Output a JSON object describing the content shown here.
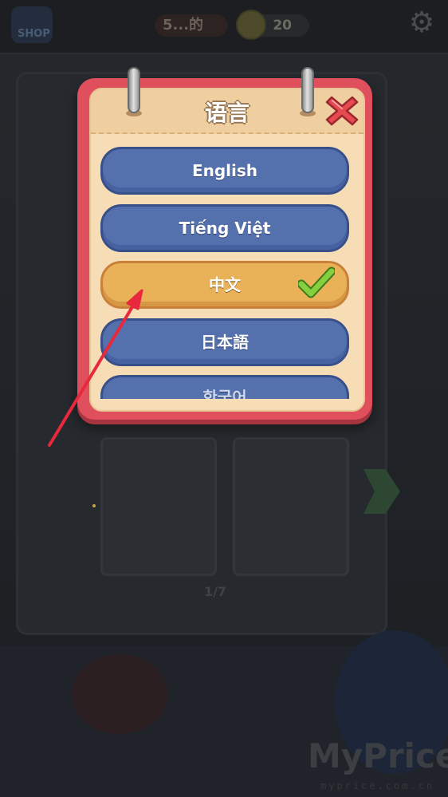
{
  "hud": {
    "level_label": "5...的",
    "coins": "20",
    "shop_label": "SHOP"
  },
  "background": {
    "page_counter": "1/7"
  },
  "dialog": {
    "title": "语言",
    "selected_language": "中文",
    "languages": [
      {
        "label": "English",
        "selected": false
      },
      {
        "label": "Tiếng Việt",
        "selected": false
      },
      {
        "label": "中文",
        "selected": true
      },
      {
        "label": "日本語",
        "selected": false
      },
      {
        "label": "한국어",
        "selected": false
      }
    ]
  },
  "watermark": {
    "brand": "MyPrice",
    "domain": "myprice.com.cn"
  },
  "colors": {
    "frame_red": "#e04f5c",
    "panel_cream": "#f6ddb6",
    "button_blue": "#5471ad",
    "button_selected_gold": "#eab258",
    "check_green": "#7cc63a",
    "annotation_red": "#e8283c"
  },
  "icons": {
    "close": "close-icon",
    "check": "check-icon",
    "settings": "gear-icon",
    "coin": "coin-icon"
  }
}
